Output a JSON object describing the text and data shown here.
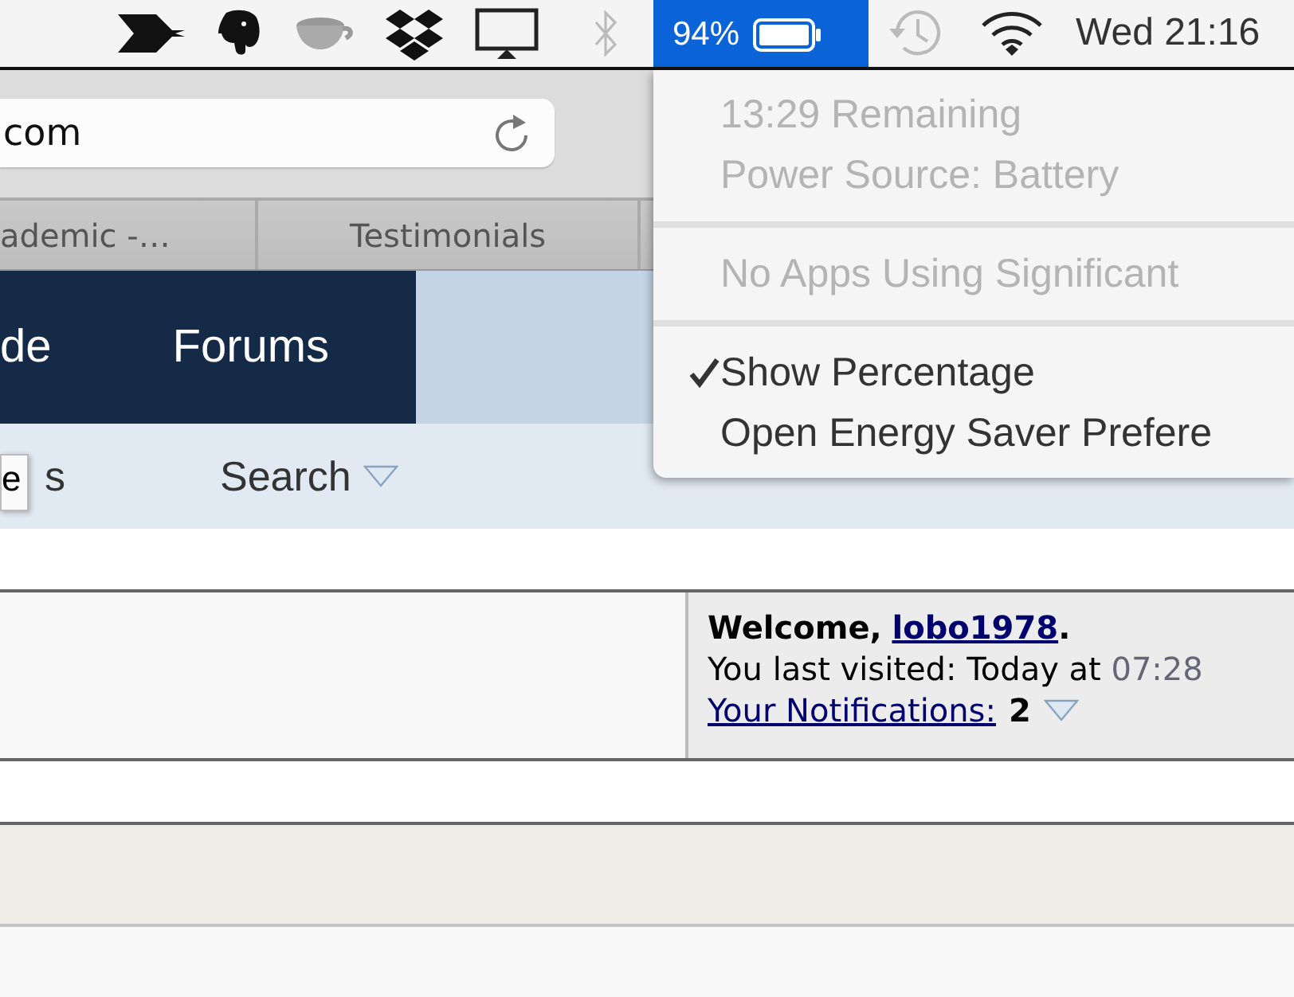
{
  "menubar": {
    "battery": {
      "percent": "94%",
      "selected": true
    },
    "clock": "Wed 21:16"
  },
  "battery_menu": {
    "items": [
      {
        "kind": "item",
        "label": "13:29 Remaining",
        "disabled": true,
        "checked": false
      },
      {
        "kind": "item",
        "label": "Power Source: Battery",
        "disabled": true,
        "checked": false
      },
      {
        "kind": "separator"
      },
      {
        "kind": "item",
        "label": "No Apps Using Significant",
        "disabled": true,
        "checked": false
      },
      {
        "kind": "separator"
      },
      {
        "kind": "item",
        "label": "Show Percentage",
        "disabled": false,
        "checked": true
      },
      {
        "kind": "item",
        "label": "Open Energy Saver Prefere",
        "disabled": false,
        "checked": false
      }
    ]
  },
  "browser": {
    "address": "com",
    "bookmarks": [
      {
        "label": "ademic -…"
      },
      {
        "label": "Testimonials"
      }
    ]
  },
  "forum": {
    "nav": [
      {
        "label": "de"
      },
      {
        "label": "Forums"
      }
    ],
    "subnav": [
      {
        "label": "s",
        "dropdown": false
      },
      {
        "label": "Search",
        "dropdown": true
      }
    ],
    "tooltip": "e",
    "welcome": {
      "greeting": "Welcome,",
      "username": "lobo1978",
      "suffix": ".",
      "last_visited": "You last visited: Today at",
      "time": "07:28",
      "notifications_label": "Your Notifications:",
      "notifications_count": "2"
    }
  }
}
